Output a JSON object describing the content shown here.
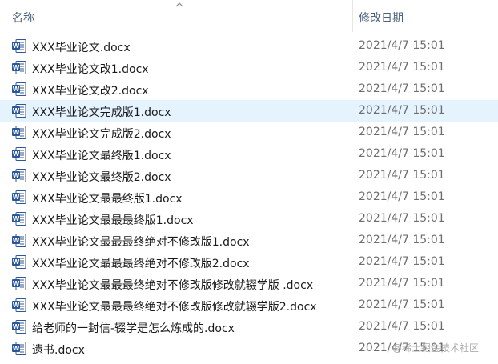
{
  "header": {
    "name_label": "名称",
    "date_label": "修改日期"
  },
  "files": [
    {
      "name": "XXX毕业论文.docx",
      "date": "2021/4/7 15:01",
      "selected": false
    },
    {
      "name": "XXX毕业论文改1.docx",
      "date": "2021/4/7 15:01",
      "selected": false
    },
    {
      "name": "XXX毕业论文改2.docx",
      "date": "2021/4/7 15:01",
      "selected": false
    },
    {
      "name": "XXX毕业论文完成版1.docx",
      "date": "2021/4/7 15:01",
      "selected": true
    },
    {
      "name": "XXX毕业论文完成版2.docx",
      "date": "2021/4/7 15:01",
      "selected": false
    },
    {
      "name": "XXX毕业论文最终版1.docx",
      "date": "2021/4/7 15:01",
      "selected": false
    },
    {
      "name": "XXX毕业论文最终版2.docx",
      "date": "2021/4/7 15:01",
      "selected": false
    },
    {
      "name": "XXX毕业论文最最终版1.docx",
      "date": "2021/4/7 15:01",
      "selected": false
    },
    {
      "name": "XXX毕业论文最最最终版1.docx",
      "date": "2021/4/7 15:01",
      "selected": false
    },
    {
      "name": "XXX毕业论文最最最终绝对不修改版1.docx",
      "date": "2021/4/7 15:01",
      "selected": false
    },
    {
      "name": "XXX毕业论文最最最终绝对不修改版2.docx",
      "date": "2021/4/7 15:01",
      "selected": false
    },
    {
      "name": "XXX毕业论文最最最终绝对不修改版修改就辍学版 .docx",
      "date": "2021/4/7 15:01",
      "selected": false
    },
    {
      "name": "XXX毕业论文最最最终绝对不修改版修改就辍学版2.docx",
      "date": "2021/4/7 15:01",
      "selected": false
    },
    {
      "name": "给老师的一封信-辍学是怎么炼成的.docx",
      "date": "2021/4/7 15:01",
      "selected": false
    },
    {
      "name": "遗书.docx",
      "date": "2021/4/7 15:01",
      "selected": false
    }
  ],
  "icons": {
    "file_icon": "word-document-icon",
    "sort_icon": "sort-ascending-arrow-icon"
  },
  "colors": {
    "selected_row": "#e5f3ff",
    "word_blue": "#2b579a"
  },
  "watermark": "@稀土掘金技术社区"
}
